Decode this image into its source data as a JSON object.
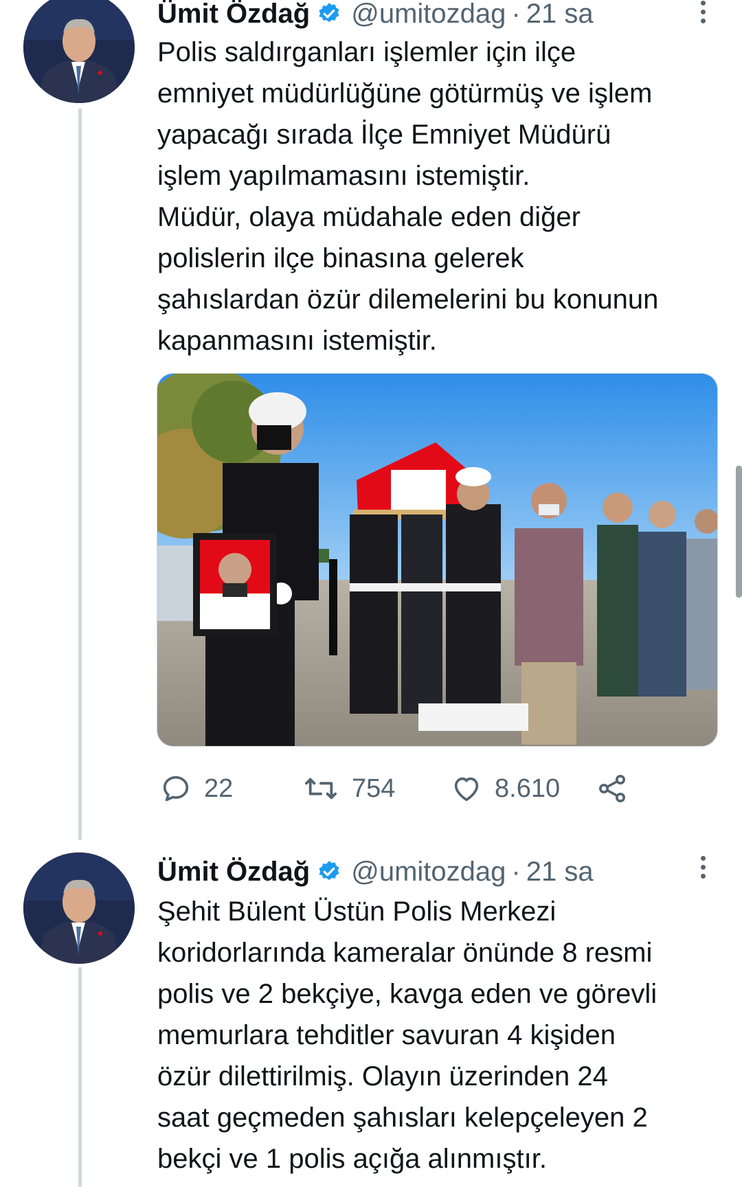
{
  "tweets": [
    {
      "author": "Ümit Özdağ",
      "handle": "@umitozdag",
      "separator": "·",
      "time": "21 sa",
      "text": "Polis saldırganları işlemler için ilçe\nemniyet müdürlüğüne götürmüş ve işlem\nyapacağı sırada İlçe Emniyet Müdürü\nişlem yapılmamasını istemiştir.\nMüdür, olaya müdahale eden diğer\npolislerin ilçe binasına gelerek\nşahıslardan özür dilemelerini bu konunun\nkapanmasını istemiştir.",
      "replies": "22",
      "retweets": "754",
      "likes": "8.610"
    },
    {
      "author": "Ümit Özdağ",
      "handle": "@umitozdag",
      "separator": "·",
      "time": "21 sa",
      "text": "Şehit Bülent Üstün Polis Merkezi\nkoridorlarında kameralar önünde 8 resmi\npolis ve 2 bekçiye, kavga eden ve görevli\nmemurlara tehditler savuran 4 kişiden\nözür dilettirilmiş. Olayın üzerinden 24\nsaat geçmeden şahısları kelepçeleyen 2\nbekçi ve 1 polis  açığa alınmıştır."
    }
  ],
  "icons": {
    "verified": "verified-badge-icon",
    "reply": "reply-icon",
    "retweet": "retweet-icon",
    "like": "heart-icon",
    "share": "share-icon",
    "more": "more-icon"
  },
  "colors": {
    "verified": "#1d9bf0",
    "secondary_text": "#536471",
    "thread_line": "#cfd9de",
    "flag_red": "#e30a17"
  }
}
